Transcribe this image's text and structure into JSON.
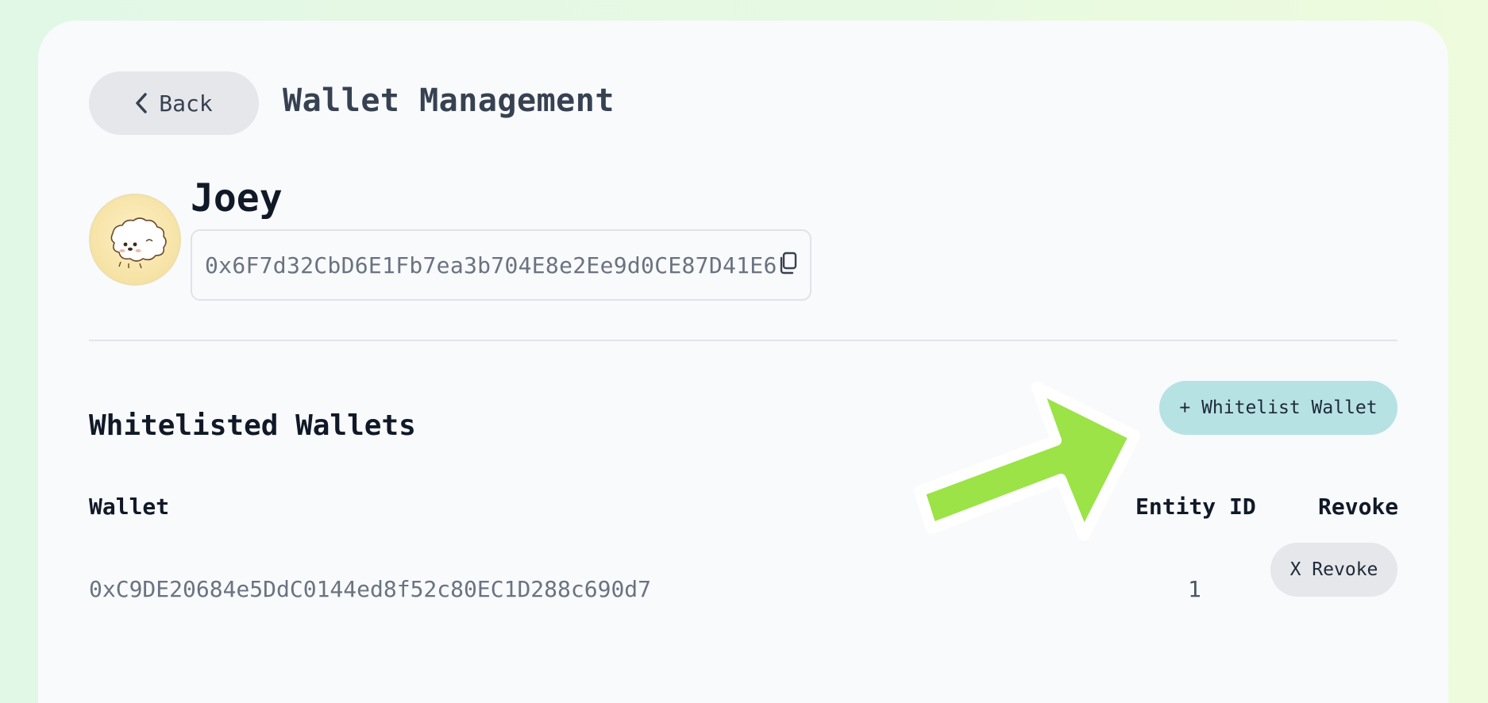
{
  "header": {
    "back_label": "Back",
    "title": "Wallet Management"
  },
  "profile": {
    "name": "Joey",
    "address": "0x6F7d32CbD6E1Fb7ea3b704E8e2Ee9d0CE87D41E6"
  },
  "whitelist": {
    "title": "Whitelisted Wallets",
    "add_button_label": "+ Whitelist Wallet",
    "columns": {
      "wallet": "Wallet",
      "entity_id": "Entity ID",
      "revoke": "Revoke"
    },
    "rows": [
      {
        "wallet": "0xC9DE20684e5DdC0144ed8f52c80EC1D288c690d7",
        "entity_id": "1",
        "revoke_label": "X Revoke"
      }
    ]
  },
  "icons": {
    "back": "chevron-left-icon",
    "copy": "copy-icon",
    "avatar": "fluffy-dog-avatar",
    "annotation": "green-arrow-annotation"
  },
  "colors": {
    "background": "#e2f8e6",
    "card": "#f8fafc",
    "primary_button": "#b6e2e4",
    "secondary_button": "#e5e7eb",
    "annotation_arrow": "#9be346"
  }
}
